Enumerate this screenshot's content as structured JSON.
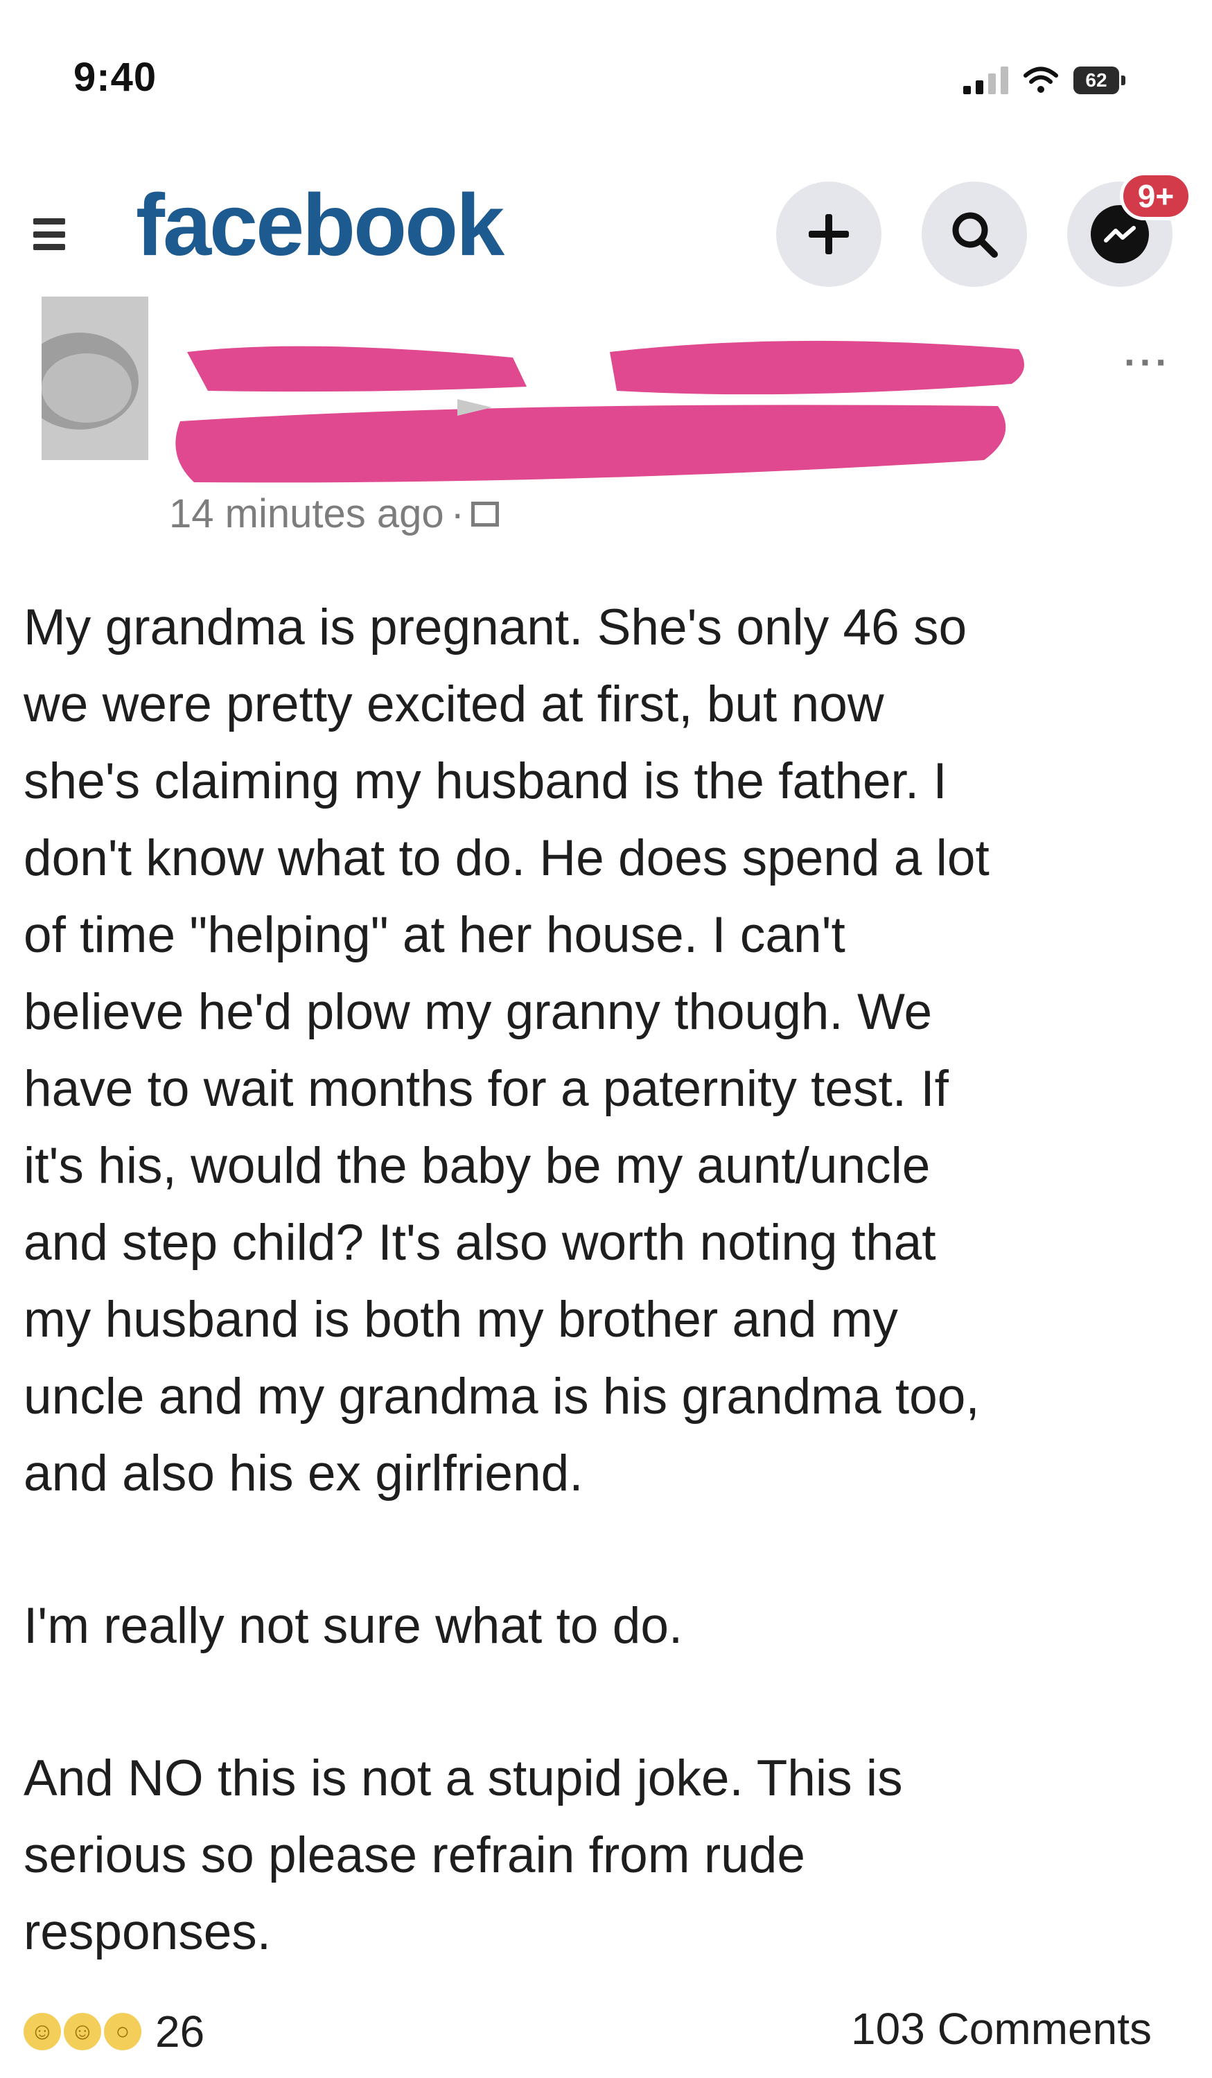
{
  "status_bar": {
    "time": "9:40",
    "battery_level": "62",
    "signal_icon": "cellular-signal-icon",
    "wifi_icon": "wifi-icon",
    "battery_icon": "battery-icon"
  },
  "header": {
    "brand": "facebook",
    "brand_color": "#1d5a8f",
    "menu_icon": "hamburger-menu-icon",
    "actions": [
      {
        "icon": "plus-icon",
        "label": "+"
      },
      {
        "icon": "search-icon"
      },
      {
        "icon": "messenger-icon"
      }
    ],
    "notification_badge": "9+",
    "badge_color": "#d33a4a"
  },
  "post": {
    "author_redacted": true,
    "redaction_color": "#e0488f",
    "timestamp": "14 minutes ago",
    "separator": "·",
    "more_icon": "more-options-icon",
    "body_lines": [
      "My grandma is pregnant. She's only 46 so",
      "we were pretty excited at first, but now",
      "she's claiming my husband is the father. I",
      "don't know what to do. He does spend a lot",
      "of time \"helping\" at her house. I can't",
      "believe he'd plow my granny though. We",
      "have to wait months for a paternity test. If",
      "it's his, would the baby be my aunt/uncle",
      "and step child? It's also worth noting that",
      "my husband is both my brother and my",
      "uncle and my grandma is his grandma too,",
      "and also his ex girlfriend."
    ],
    "paragraph_2": "I'm really not sure what to do.",
    "paragraph_3_lines": [
      "And NO this is not a stupid joke. This is",
      "serious so please refrain from rude",
      "responses."
    ]
  },
  "footer": {
    "reaction_count": "26",
    "comments": "103 Comments",
    "reaction_icons": [
      "laugh-reaction-icon",
      "laugh-reaction-icon",
      "wow-reaction-icon"
    ]
  }
}
